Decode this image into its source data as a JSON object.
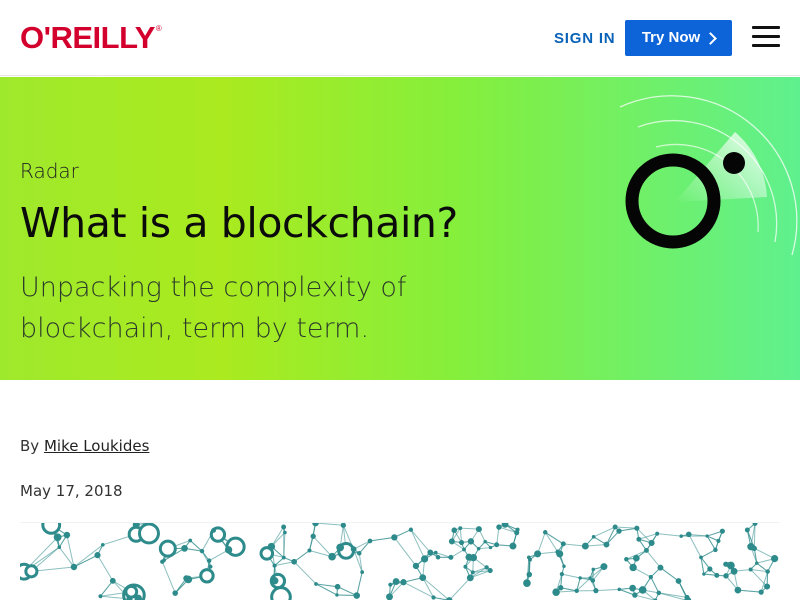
{
  "header": {
    "logo_text": "O'REILLY",
    "logo_mark": "®",
    "sign_in_label": "SIGN IN",
    "try_now_label": "Try Now",
    "menu_icon": "hamburger-menu-icon"
  },
  "hero": {
    "kicker": "Radar",
    "title": "What is a blockchain?",
    "subtitle": "Unpacking the complexity of blockchain, term by term.",
    "graphic_icon": "radar-icon"
  },
  "article": {
    "byline_prefix": "By",
    "author": "Mike Loukides",
    "date": "May 17, 2018",
    "image_icon": "blockchain-network-illustration"
  },
  "colors": {
    "brand_red": "#d3002d",
    "link_blue": "#0a62b8",
    "button_blue": "#0d64d8",
    "hero_green_start": "#9fe92c",
    "hero_green_end": "#5ff08e",
    "network_teal": "#2e8b8b"
  }
}
